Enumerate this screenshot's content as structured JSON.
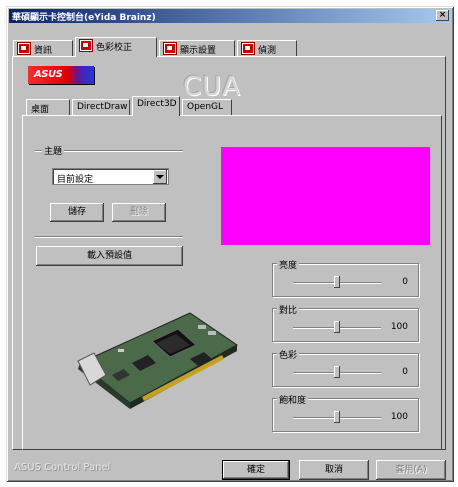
{
  "window": {
    "title": "華碩顯示卡控制台(eYida Brainz)",
    "close": "×"
  },
  "tabs": [
    {
      "label": "資訊"
    },
    {
      "label": "色彩校正"
    },
    {
      "label": "顯示設置"
    },
    {
      "label": "偵測"
    }
  ],
  "brand": {
    "logo": "ASUS",
    "product": "CUA"
  },
  "subtabs": [
    {
      "label": "桌面"
    },
    {
      "label": "DirectDraw"
    },
    {
      "label": "Direct3D"
    },
    {
      "label": "OpenGL"
    }
  ],
  "scheme": {
    "group_label": "主題",
    "selected": "目前設定",
    "save_label": "儲存",
    "delete_label": "刪除",
    "load_default_label": "載入預設值"
  },
  "preview": {
    "color": "#ff00ff"
  },
  "sliders": [
    {
      "label": "亮度",
      "value": "0",
      "fraction": 0.5
    },
    {
      "label": "對比",
      "value": "100",
      "fraction": 0.5
    },
    {
      "label": "色彩",
      "value": "0",
      "fraction": 0.5
    },
    {
      "label": "飽和度",
      "value": "100",
      "fraction": 0.5
    }
  ],
  "footer": {
    "product": "ASUS Control Panel",
    "ok_label": "確定",
    "cancel_label": "取消",
    "apply_label": "套用(A)"
  }
}
